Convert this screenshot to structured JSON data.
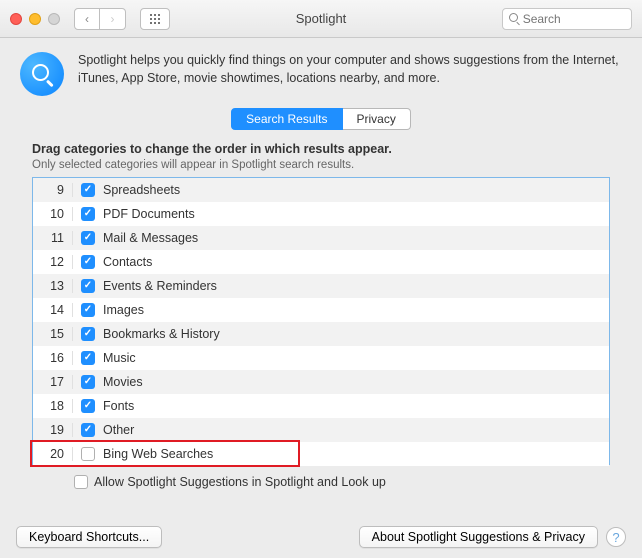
{
  "window": {
    "title": "Spotlight",
    "search_placeholder": "Search"
  },
  "header": {
    "description": "Spotlight helps you quickly find things on your computer and shows suggestions from the Internet, iTunes, App Store, movie showtimes, locations nearby, and more."
  },
  "tabs": {
    "results": "Search Results",
    "privacy": "Privacy"
  },
  "instructions": {
    "bold": "Drag categories to change the order in which results appear.",
    "sub": "Only selected categories will appear in Spotlight search results."
  },
  "categories": [
    {
      "n": "9",
      "checked": true,
      "label": "Spreadsheets"
    },
    {
      "n": "10",
      "checked": true,
      "label": "PDF Documents"
    },
    {
      "n": "11",
      "checked": true,
      "label": "Mail & Messages"
    },
    {
      "n": "12",
      "checked": true,
      "label": "Contacts"
    },
    {
      "n": "13",
      "checked": true,
      "label": "Events & Reminders"
    },
    {
      "n": "14",
      "checked": true,
      "label": "Images"
    },
    {
      "n": "15",
      "checked": true,
      "label": "Bookmarks & History"
    },
    {
      "n": "16",
      "checked": true,
      "label": "Music"
    },
    {
      "n": "17",
      "checked": true,
      "label": "Movies"
    },
    {
      "n": "18",
      "checked": true,
      "label": "Fonts"
    },
    {
      "n": "19",
      "checked": true,
      "label": "Other"
    },
    {
      "n": "20",
      "checked": false,
      "label": "Bing Web Searches"
    }
  ],
  "allow_suggestions": {
    "checked": false,
    "label": "Allow Spotlight Suggestions in Spotlight and Look up"
  },
  "footer": {
    "keyboard": "Keyboard Shortcuts...",
    "about": "About Spotlight Suggestions & Privacy",
    "help": "?"
  }
}
